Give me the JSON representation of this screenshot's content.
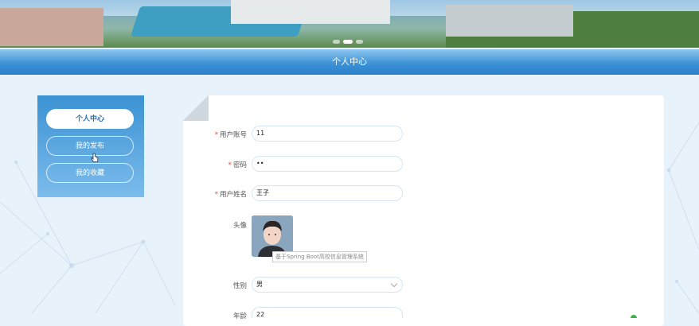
{
  "page": {
    "title": "个人中心"
  },
  "banner": {
    "slide_count": 3,
    "active_slide_index": 1
  },
  "sidebar": {
    "items": [
      {
        "label": "个人中心",
        "active": true
      },
      {
        "label": "我的发布",
        "active": false
      },
      {
        "label": "我的收藏",
        "active": false
      }
    ]
  },
  "form": {
    "fields": [
      {
        "label": "用户账号",
        "required": true,
        "value": "11"
      },
      {
        "label": "密码",
        "required": true,
        "value": "••"
      },
      {
        "label": "用户姓名",
        "required": true,
        "value": "王子"
      },
      {
        "label": "头像",
        "required": false,
        "value": ""
      },
      {
        "label": "性别",
        "required": false,
        "value": "男"
      },
      {
        "label": "年龄",
        "required": false,
        "value": "22"
      }
    ],
    "required_mark": "*",
    "avatar_tooltip": "基于Spring Boot高校信息管理系统"
  },
  "colors": {
    "accent": "#2a7fc9",
    "required": "#e74c3c",
    "input_border": "#d4e6f5"
  }
}
